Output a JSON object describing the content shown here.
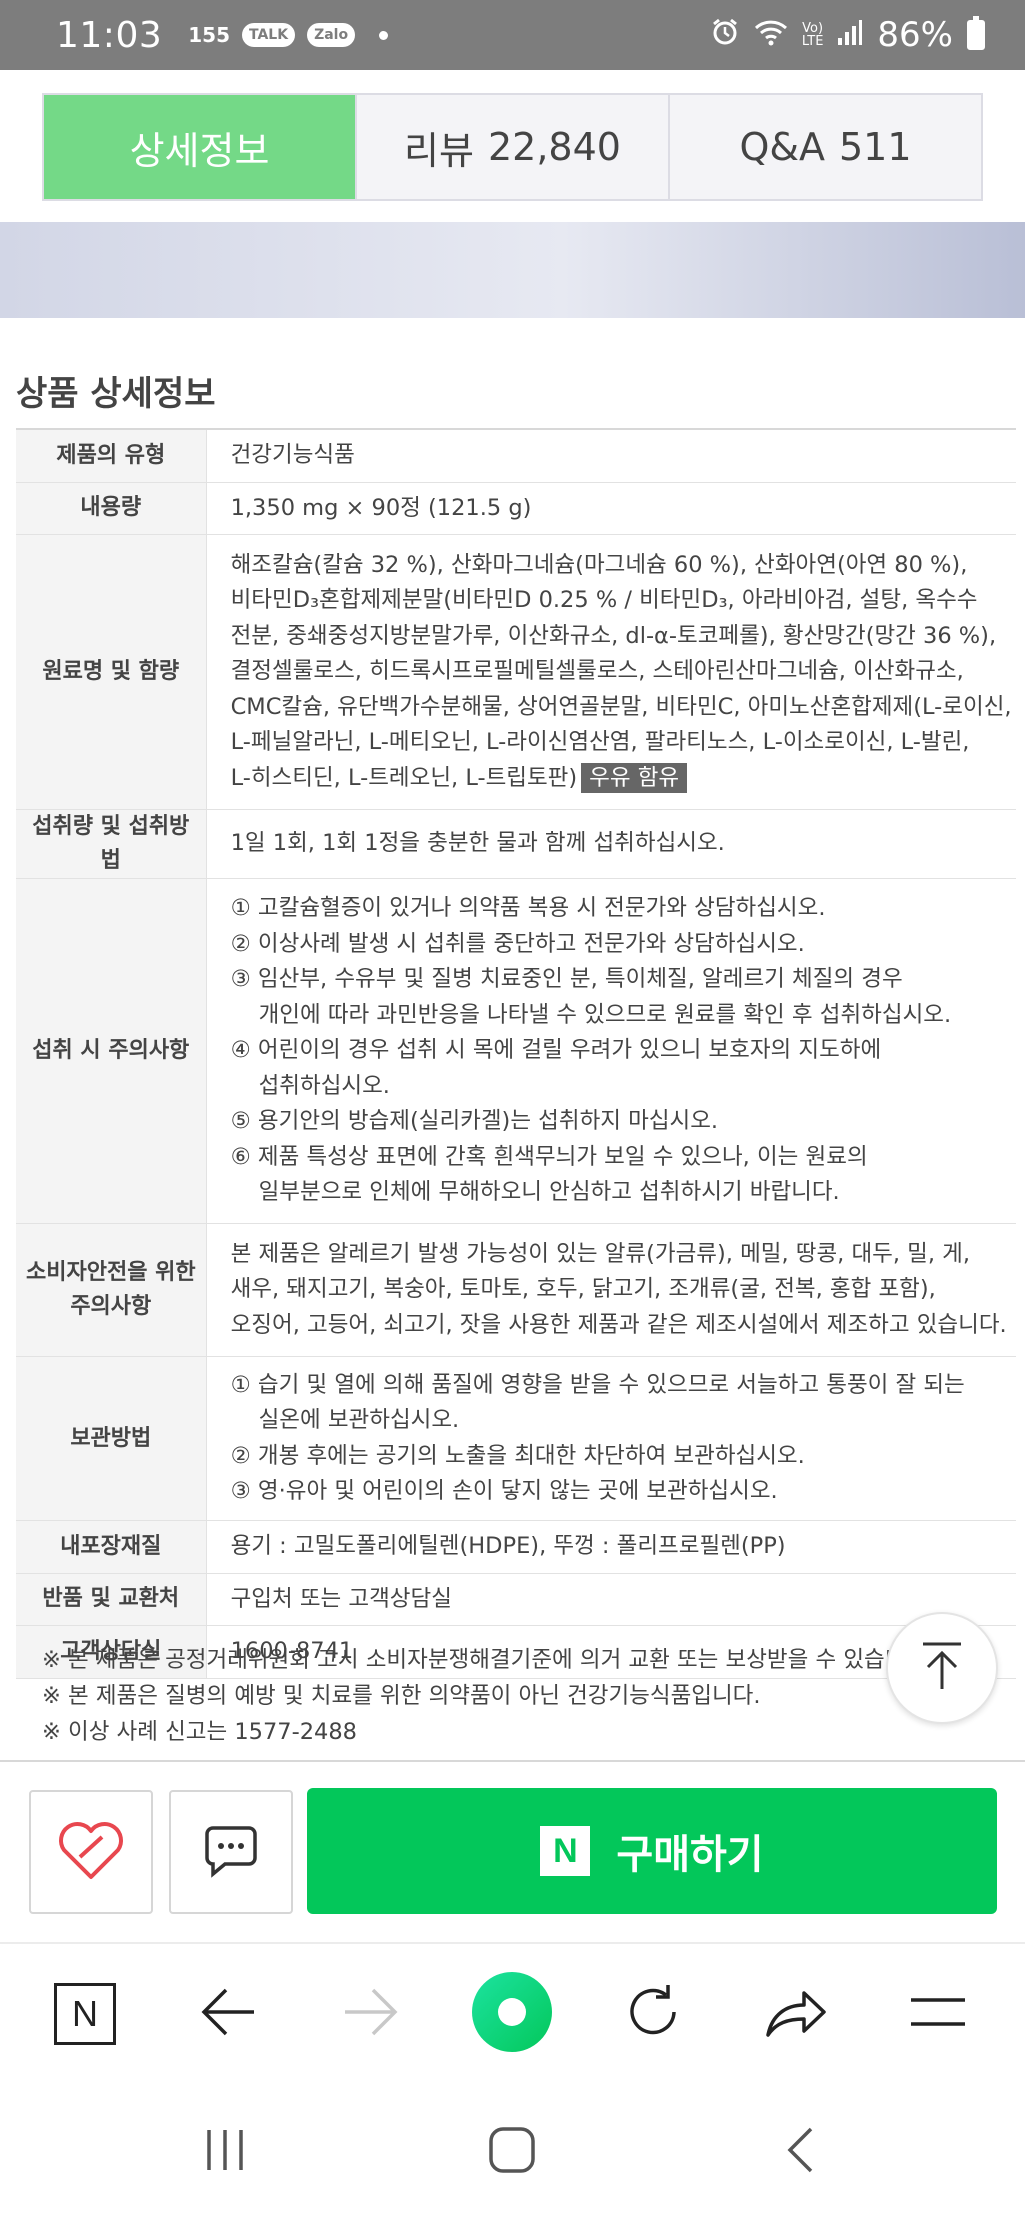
{
  "status_bar": {
    "time": "11:03",
    "notif_count": "155",
    "chip_talk": "TALK",
    "chip_zalo": "Zalo",
    "signal_label": "Vo)\nLTE",
    "battery": "86%"
  },
  "tabs": [
    {
      "label": "상세정보",
      "count": ""
    },
    {
      "label": "리뷰",
      "count": "22,840"
    },
    {
      "label": "Q&A",
      "count": "511"
    }
  ],
  "section_title": "상품 상세정보",
  "rows": {
    "type": {
      "header": "제품의 유형",
      "value": "건강기능식품"
    },
    "amount": {
      "header": "내용량",
      "value": "1,350 mg × 90정 (121.5 g)"
    },
    "ingredients": {
      "header": "원료명 및 함량",
      "lines": [
        "해조칼슘(칼슘 32 %), 산화마그네슘(마그네슘 60 %), 산화아연(아연 80 %),",
        "비타민D₃혼합제제분말(비타민D 0.25 % / 비타민D₃, 아라비아검, 설탕, 옥수수",
        "전분, 중쇄중성지방분말가루, 이산화규소, dl-α-토코페롤), 황산망간(망간 36 %),",
        "결정셀룰로스, 히드록시프로필메틸셀룰로스, 스테아린산마그네슘, 이산화규소,",
        "CMC칼슘, 유단백가수분해물, 상어연골분말, 비타민C, 아미노산혼합제제(L-로이신,",
        "L-페닐알라닌, L-메티오닌, L-라이신염산염, 팔라티노스, L-이소로이신, L-발린,",
        "L-히스티딘, L-트레오닌, L-트립토판)"
      ],
      "milk_tag": "우유 함유"
    },
    "intake": {
      "header": "섭취량 및 섭취방법",
      "value": "1일 1회, 1회 1정을 충분한 물과 함께 섭취하십시오."
    },
    "cautions": {
      "header": "섭취 시 주의사항",
      "lines": [
        {
          "text": "① 고칼슘혈증이 있거나 의약품 복용 시 전문가와 상담하십시오.",
          "indent": false
        },
        {
          "text": "② 이상사례 발생 시 섭취를 중단하고 전문가와 상담하십시오.",
          "indent": false
        },
        {
          "text": "③ 임산부, 수유부 및 질병 치료중인 분, 특이체질, 알레르기 체질의 경우",
          "indent": false
        },
        {
          "text": "개인에 따라 과민반응을 나타낼 수 있으므로 원료를 확인 후 섭취하십시오.",
          "indent": true
        },
        {
          "text": "④ 어린이의 경우 섭취 시 목에 걸릴 우려가 있으니 보호자의 지도하에",
          "indent": false
        },
        {
          "text": "섭취하십시오.",
          "indent": true
        },
        {
          "text": "⑤ 용기안의 방습제(실리카겔)는 섭취하지 마십시오.",
          "indent": false
        },
        {
          "text": "⑥ 제품 특성상 표면에 간혹 흰색무늬가 보일 수 있으나, 이는 원료의",
          "indent": false
        },
        {
          "text": "일부분으로 인체에 무해하오니 안심하고 섭취하시기 바랍니다.",
          "indent": true
        }
      ]
    },
    "consumer_safety": {
      "header_line1": "소비자안전을 위한",
      "header_line2": "주의사항",
      "lines": [
        "본 제품은 알레르기 발생 가능성이 있는 알류(가금류), 메밀, 땅콩, 대두, 밀, 게,",
        "새우, 돼지고기, 복숭아, 토마토, 호두, 닭고기, 조개류(굴, 전복, 홍합 포함),",
        "오징어, 고등어, 쇠고기, 잣을 사용한 제품과 같은 제조시설에서 제조하고 있습니다."
      ]
    },
    "storage": {
      "header": "보관방법",
      "lines": [
        {
          "text": "① 습기 및 열에 의해 품질에 영향을 받을 수 있으므로 서늘하고 통풍이 잘 되는",
          "indent": false
        },
        {
          "text": "실온에 보관하십시오.",
          "indent": true
        },
        {
          "text": "② 개봉 후에는 공기의 노출을 최대한 차단하여 보관하십시오.",
          "indent": false
        },
        {
          "text": "③ 영·유아 및 어린이의 손이 닿지 않는 곳에 보관하십시오.",
          "indent": false
        }
      ]
    },
    "packaging": {
      "header": "내포장재질",
      "value": "용기 : 고밀도폴리에틸렌(HDPE), 뚜껑 : 폴리프로필렌(PP)"
    },
    "returns": {
      "header": "반품 및 교환처",
      "value": "구입처 또는 고객상담실"
    },
    "support": {
      "header": "고객상담실",
      "value": "1600-8741"
    }
  },
  "notes": [
    "※ 본 제품은 공정거래위원회 고시 소비자분쟁해결기준에 의거 교환 또는 보상받을 수 있습니다.",
    "※ 본 제품은 질병의 예방 및 치료를 위한 의약품이 아닌 건강기능식품입니다.",
    "※ 이상 사례 신고는 1577-2488"
  ],
  "buy_bar": {
    "buy_label": "구매하기",
    "buy_logo": "N",
    "heart_color": "#e8474f",
    "buy_color": "#03c75a"
  },
  "browser_toolbar": {
    "home_logo": "N",
    "icons": [
      "naver-home-icon",
      "back-arrow-icon",
      "forward-arrow-icon",
      "green-dot-icon",
      "refresh-icon",
      "share-icon",
      "menu-icon"
    ]
  },
  "android_nav": {
    "icons": [
      "recent-apps-icon",
      "home-icon",
      "back-icon"
    ]
  },
  "accent": {
    "active_tab": "#74d987",
    "naver_green": "#03c75a"
  }
}
